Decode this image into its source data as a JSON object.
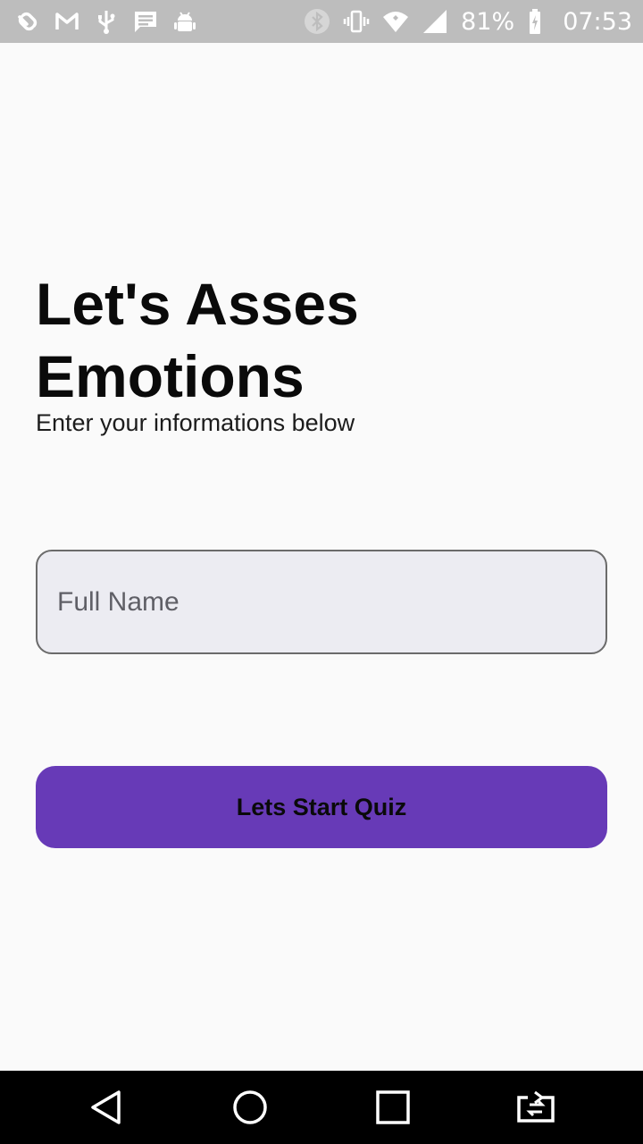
{
  "status_bar": {
    "left_icons": [
      "link-icon",
      "gmail-icon",
      "usb-icon",
      "message-icon",
      "android-debug-icon"
    ],
    "right_icons": [
      "bluetooth-icon",
      "vibrate-icon",
      "wifi-icon",
      "signal-icon",
      "battery-icon"
    ],
    "battery_percent": "81%",
    "time": "07:53"
  },
  "screen": {
    "title": "Let's Asses Emotions",
    "subtitle": "Enter your informations below",
    "name_field": {
      "value": "",
      "placeholder": "Full Name"
    },
    "start_button_label": "Lets Start Quiz"
  },
  "colors": {
    "accent": "#673ab7",
    "background": "#fafafa",
    "field_fill": "#ececf2",
    "status_bar": "#bdbdbd",
    "nav_bar": "#000000"
  },
  "nav_bar": {
    "buttons": [
      "back-icon",
      "home-icon",
      "recents-icon",
      "screen-switch-icon"
    ]
  }
}
